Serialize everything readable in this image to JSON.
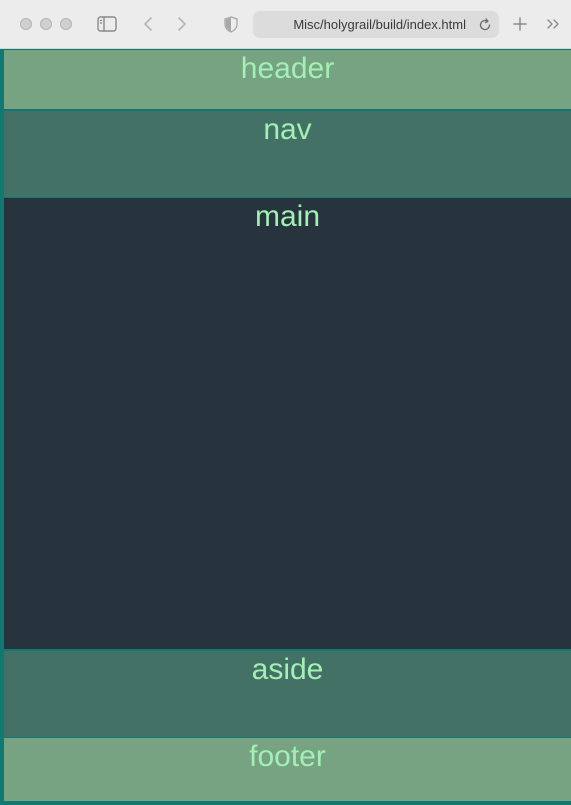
{
  "browser": {
    "url": "Misc/holygrail/build/index.html",
    "icons": {
      "sidebar": "sidebar-icon",
      "back": "chevron-left-icon",
      "forward": "chevron-right-icon",
      "privacy": "shield-icon",
      "reload": "reload-icon",
      "new_tab": "plus-icon",
      "overflow": "double-chevron-icon"
    }
  },
  "page": {
    "header": "header",
    "nav": "nav",
    "main": "main",
    "aside": "aside",
    "footer": "footer"
  },
  "colors": {
    "header_bg": "#77a383",
    "nav_bg": "#447165",
    "main_bg": "#28343d",
    "aside_bg": "#447165",
    "footer_bg": "#77a383",
    "border": "#107a72",
    "text": "#a2f0b4"
  }
}
